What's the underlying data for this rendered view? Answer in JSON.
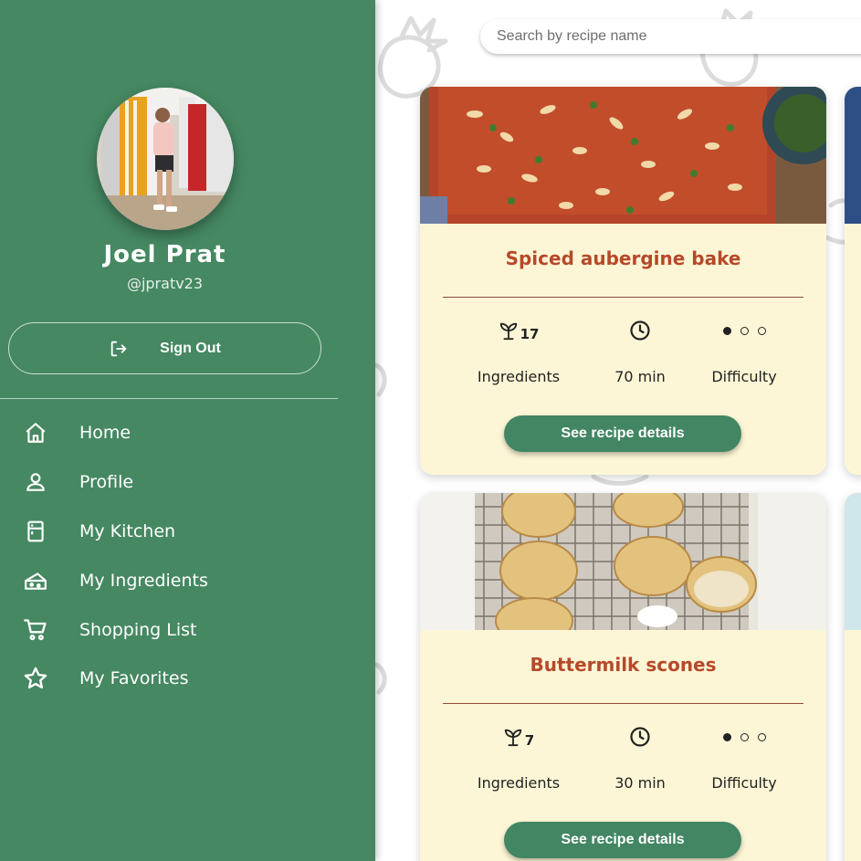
{
  "search": {
    "placeholder": "Search by recipe name"
  },
  "user": {
    "name": "Joel Prat",
    "handle": "@jpratv23"
  },
  "signout_label": "Sign Out",
  "nav": [
    {
      "label": "Home",
      "icon": "home-icon"
    },
    {
      "label": "Profile",
      "icon": "person-icon"
    },
    {
      "label": "My Kitchen",
      "icon": "fridge-icon"
    },
    {
      "label": "My Ingredients",
      "icon": "cheese-icon"
    },
    {
      "label": "Shopping List",
      "icon": "cart-icon"
    },
    {
      "label": "My Favorites",
      "icon": "star-icon"
    }
  ],
  "recipes": [
    {
      "title": "Spiced aubergine bake",
      "ingredients_count": "17",
      "ingredients_label": "Ingredients",
      "time": "70 min",
      "difficulty_label": "Difficulty",
      "difficulty_level": 1,
      "difficulty_max": 3,
      "button_label": "See recipe details"
    },
    {
      "title": "Buttermilk scones",
      "ingredients_count": "7",
      "ingredients_label": "Ingredients",
      "time": "30 min",
      "difficulty_label": "Difficulty",
      "difficulty_level": 1,
      "difficulty_max": 3,
      "button_label": "See recipe details"
    }
  ],
  "colors": {
    "drawer": "#458862",
    "button": "#428663",
    "card_bg": "#fdf6d6",
    "recipe_title": "#b6492a"
  }
}
